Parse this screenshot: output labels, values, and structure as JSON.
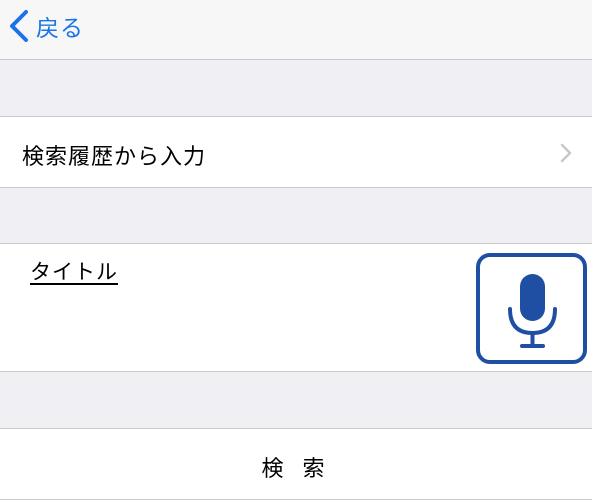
{
  "navbar": {
    "back_label": "戻る",
    "back_icon": "chevron-left-icon"
  },
  "history_row": {
    "label": "検索履歴から入力",
    "icon": "chevron-right-icon"
  },
  "title_row": {
    "label": "タイトル",
    "mic_icon": "microphone-icon"
  },
  "search_row": {
    "label": "検 索"
  },
  "colors": {
    "accent": "#1a73e8",
    "mic_border": "#1f4fa3",
    "background": "#efeff4",
    "separator": "#c8c7cc"
  }
}
